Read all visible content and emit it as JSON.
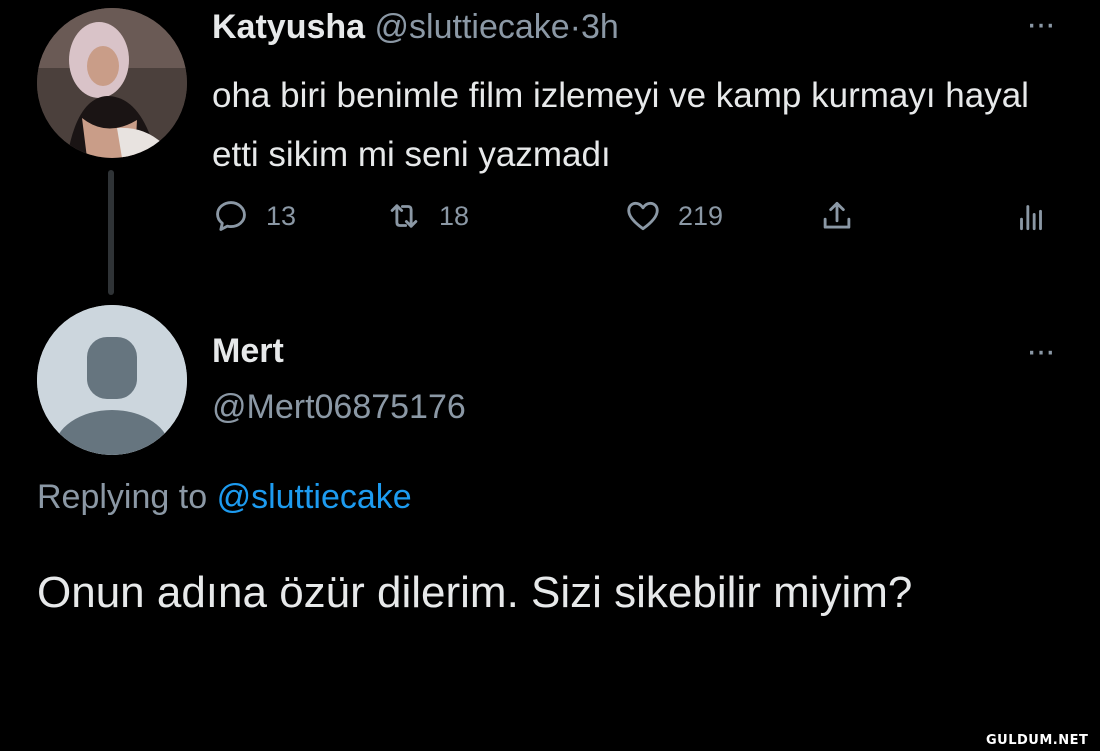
{
  "tweet1": {
    "display_name": "Katyusha",
    "handle": "@sluttiecake",
    "separator": "·",
    "time": "3h",
    "text": "oha biri benimle film izlemeyi ve kamp kurmayı hayal etti sikim mi seni yazmadı",
    "more": "···",
    "reply_count": "13",
    "retweet_count": "18",
    "like_count": "219",
    "icons": [
      "reply-icon",
      "retweet-icon",
      "like-icon",
      "share-icon",
      "analytics-icon"
    ]
  },
  "tweet2": {
    "display_name": "Mert",
    "handle": "@Mert06875176",
    "more": "···",
    "replying_prefix": "Replying to",
    "replying_handle": "@sluttiecake",
    "text": "Onun adına özür dilerim. Sizi sikebilir miyim?"
  },
  "watermark": "GULDUM.NET",
  "colors": {
    "background": "#000000",
    "text": "#e7e9ea",
    "muted": "#8b98a5",
    "link": "#1d9bf0",
    "default_avatar": "#ccd6dd"
  }
}
